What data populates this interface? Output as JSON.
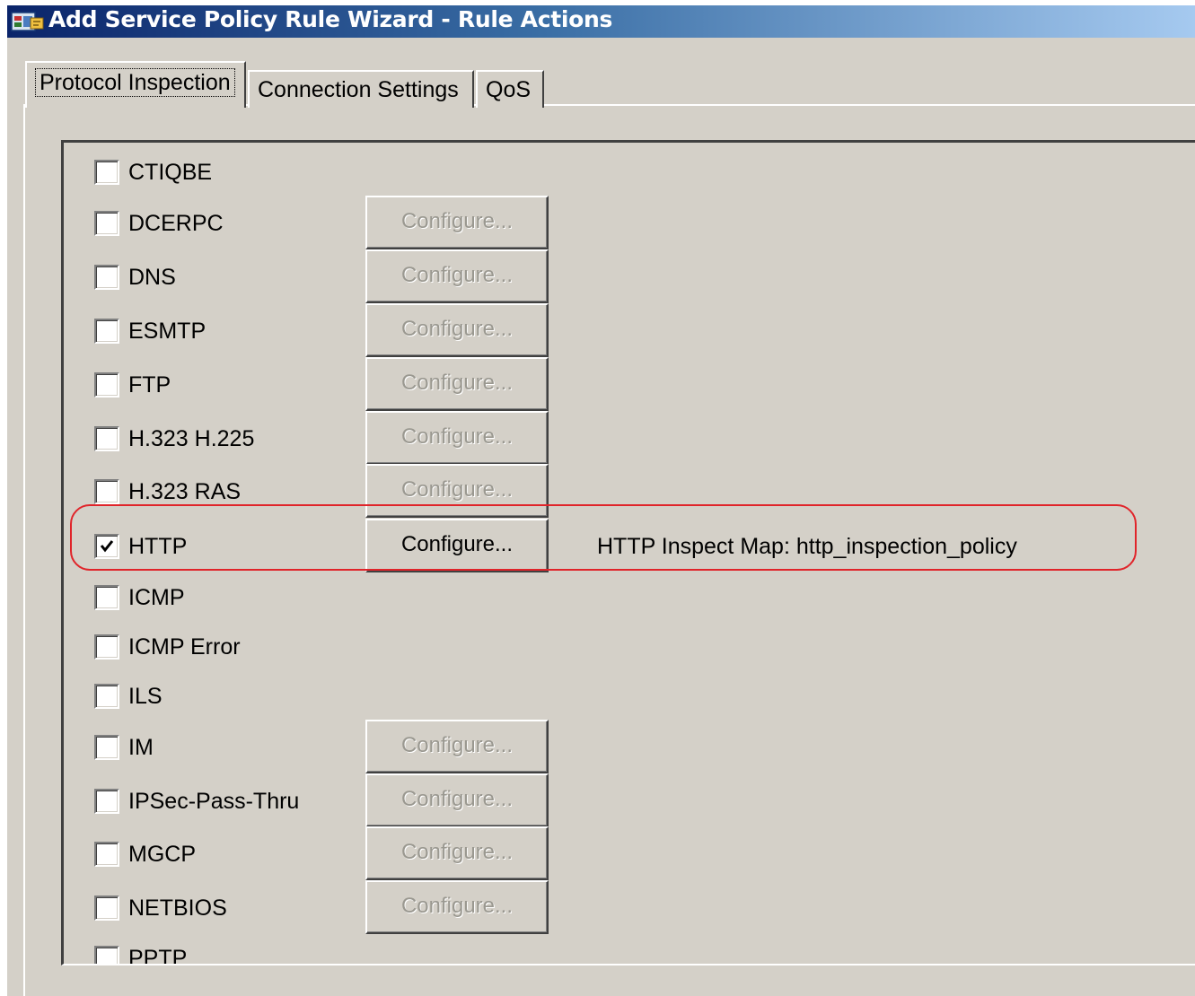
{
  "window": {
    "title": "Add Service Policy Rule Wizard - Rule Actions",
    "icon": "app-icon"
  },
  "tabs": [
    {
      "label": "Protocol Inspection",
      "active": true
    },
    {
      "label": "Connection Settings",
      "active": false
    },
    {
      "label": "QoS",
      "active": false
    }
  ],
  "configure_label": "Configure...",
  "protocols": [
    {
      "label": "CTIQBE",
      "checked": false,
      "configure": null
    },
    {
      "label": "DCERPC",
      "checked": false,
      "configure": "disabled"
    },
    {
      "label": "DNS",
      "checked": false,
      "configure": "disabled"
    },
    {
      "label": "ESMTP",
      "checked": false,
      "configure": "disabled"
    },
    {
      "label": "FTP",
      "checked": false,
      "configure": "disabled"
    },
    {
      "label": "H.323 H.225",
      "checked": false,
      "configure": "disabled"
    },
    {
      "label": "H.323 RAS",
      "checked": false,
      "configure": "disabled"
    },
    {
      "label": "HTTP",
      "checked": true,
      "configure": "enabled",
      "map_text": "HTTP Inspect Map: http_inspection_policy"
    },
    {
      "label": "ICMP",
      "checked": false,
      "configure": null
    },
    {
      "label": "ICMP Error",
      "checked": false,
      "configure": null
    },
    {
      "label": "ILS",
      "checked": false,
      "configure": null
    },
    {
      "label": "IM",
      "checked": false,
      "configure": "disabled"
    },
    {
      "label": "IPSec-Pass-Thru",
      "checked": false,
      "configure": "disabled"
    },
    {
      "label": "MGCP",
      "checked": false,
      "configure": "disabled"
    },
    {
      "label": "NETBIOS",
      "checked": false,
      "configure": "disabled"
    },
    {
      "label": "PPTP",
      "checked": false,
      "configure": null
    }
  ],
  "colors": {
    "highlight": "#e0242a",
    "dialog_bg": "#d4d0c8",
    "title_start": "#0a246a",
    "title_end": "#a6caf0"
  }
}
